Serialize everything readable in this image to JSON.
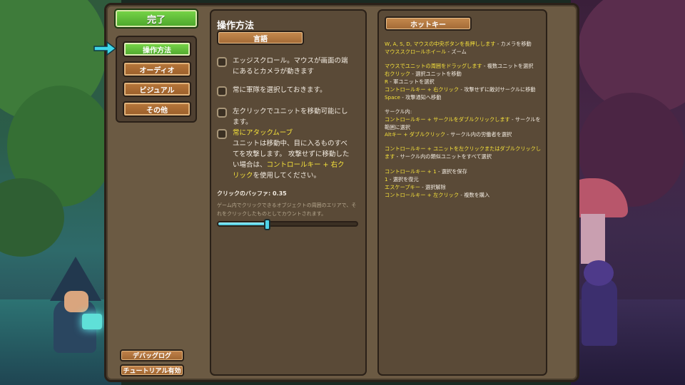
{
  "left_nav": {
    "done_label": "完了",
    "items": [
      {
        "label": "操作方法",
        "active": true
      },
      {
        "label": "オーディオ",
        "active": false
      },
      {
        "label": "ビジュアル",
        "active": false
      },
      {
        "label": "その他",
        "active": false
      }
    ],
    "debug_log_label": "デバッグログ",
    "tutorial_label": "チュートリアル有効"
  },
  "controls": {
    "title": "操作方法",
    "language_label": "言語",
    "options": {
      "edge_scroll": "エッジスクロール。マウスが画面の端にあるとカメラが動きます",
      "always_select_army": "常に軍隊を選択しておきます。",
      "left_click_move": "左クリックでユニットを移動可能にします。",
      "attack_move_title": "常にアタックムーブ",
      "attack_move_desc_1": "ユニットは移動中、目に入るものすべてを攻撃します。 攻撃せずに移動したい場合は、",
      "attack_move_key": "コントロールキー + 右クリック",
      "attack_move_desc_2": "を使用してください。"
    },
    "click_buffer_label": "クリックのバッファ: 0.35",
    "click_buffer_value": 0.35,
    "click_buffer_desc": "ゲーム内でクリックできるオブジェクトの周囲のエリアで、それをクリックしたものとしてカウントされます。"
  },
  "hotkeys": {
    "title": "ホットキー",
    "g1_l1_key": "W, A, S, D, マウスの中央ボタンを長押しします",
    "g1_l1_act": " - カメラを移動",
    "g1_l2_key": "マウススクロールホイール",
    "g1_l2_act": " - ズーム",
    "g2_l1_key": "マウスでユニットの周囲をドラッグします",
    "g2_l1_act": " - 複数ユニットを選択",
    "g2_l2_key": "右クリック",
    "g2_l2_act": " - 選択ユニットを移動",
    "g2_l3_key": "R",
    "g2_l3_act": " - 軍ユニットを選択",
    "g2_l4_key": "コントロールキー + 右クリック",
    "g2_l4_act": " - 攻撃せずに敵対サークルに移動",
    "g2_l5_key": "Space",
    "g2_l5_act": " - 攻撃通知へ移動",
    "g3_heading": "サークル内:",
    "g3_l1_key": "コントロールキー + サークルをダブルクリックします",
    "g3_l1_act": " - サークルを範囲に選択",
    "g3_l2_key": "Altキー + ダブルクリック",
    "g3_l2_act": " - サークル内の労働者を選択",
    "g4_l1_key": "コントロールキー + ユニットを左クリックまたはダブルクリックします",
    "g4_l1_act": " - サークル内の類似ユニットをすべて選択",
    "g5_l1_key": "コントロールキー + 1",
    "g5_l1_act": " - 選択を保存",
    "g5_l2_key": "1",
    "g5_l2_act": " - 選択を復元",
    "g5_l3_key": "エスケープキー",
    "g5_l3_act": " - 選択解除",
    "g5_l4_key": "コントロールキー + 左クリック",
    "g5_l4_act": " - 複数を購入"
  },
  "colors": {
    "accent_green": "#4aa52a",
    "button_orange": "#a36a36",
    "highlight_yellow": "#f5e13a",
    "slider_cyan": "#3fc1d6",
    "arrow_cyan": "#3fd6e8"
  }
}
